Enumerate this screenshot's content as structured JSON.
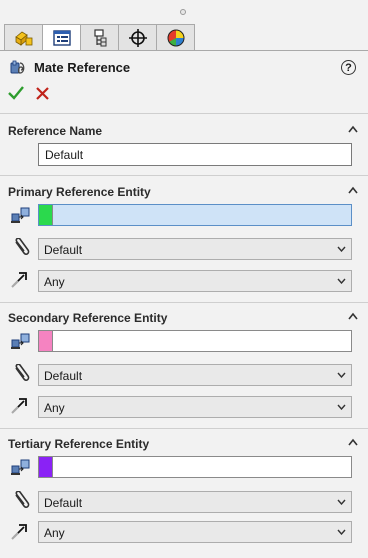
{
  "window": {
    "title": "Mate Reference",
    "tabs": [
      {
        "name": "feature-manager"
      },
      {
        "name": "property-manager"
      },
      {
        "name": "configuration-manager"
      },
      {
        "name": "dimxpert-manager"
      },
      {
        "name": "display-manager"
      }
    ]
  },
  "actions": {
    "ok": "check-icon",
    "cancel": "x-icon",
    "help": "?"
  },
  "sections": {
    "reference_name": {
      "heading": "Reference Name",
      "value": "Default"
    },
    "primary": {
      "heading": "Primary Reference Entity",
      "swatch_color": "#2bd94d",
      "alignment_value": "Default",
      "type_value": "Any"
    },
    "secondary": {
      "heading": "Secondary Reference Entity",
      "swatch_color": "#f583c1",
      "alignment_value": "Default",
      "type_value": "Any"
    },
    "tertiary": {
      "heading": "Tertiary Reference Entity",
      "swatch_color": "#8a22f5",
      "alignment_value": "Default",
      "type_value": "Any"
    }
  },
  "colors": {
    "accept": "#2e9d2e",
    "reject": "#c0231a",
    "active_field": "#cfe3f7"
  }
}
